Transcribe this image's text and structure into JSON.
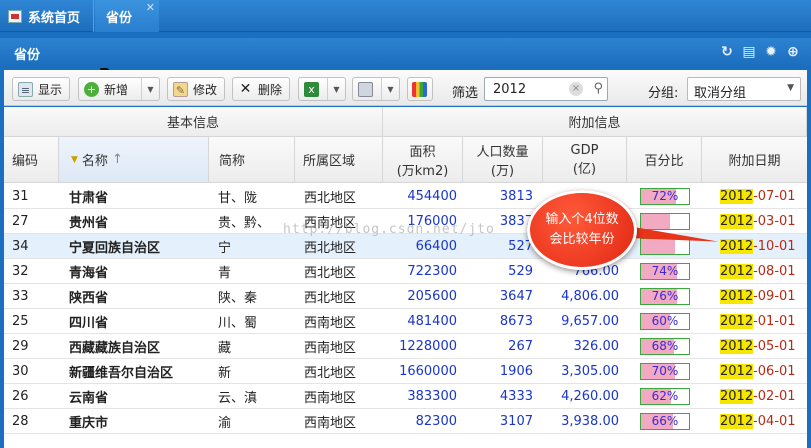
{
  "tabs": [
    {
      "label": "系统首页",
      "close": ""
    },
    {
      "label": "省份",
      "close": "✕"
    }
  ],
  "panel": {
    "title": "省份"
  },
  "header_icons": [
    "refresh-icon",
    "print-icon",
    "gear-icon",
    "add-circle-icon"
  ],
  "toolbar": {
    "show_label": "显示",
    "add_label": "新增",
    "edit_label": "修改",
    "delete_label": "删除",
    "filter_label": "筛选",
    "search_value": "2012",
    "group_label": "分组:",
    "group_value": "取消分组"
  },
  "columns": {
    "group_basic": "基本信息",
    "group_extra": "附加信息",
    "code": "编码",
    "name": "名称",
    "abbr": "简称",
    "region": "所属区域",
    "area_1": "面积",
    "area_2": "(万km2)",
    "pop_1": "人口数量",
    "pop_2": "(万)",
    "gdp_1": "GDP",
    "gdp_2": "(亿)",
    "pct": "百分比",
    "date": "附加日期"
  },
  "rows": [
    {
      "code": "31",
      "name": "甘肃省",
      "abbr": "甘、陇",
      "region": "西北地区",
      "area": "454400",
      "pop": "3813",
      "gdp": "",
      "pct_text": "72%",
      "pct": 0.72,
      "year": "2012",
      "date_rest": "-07-01"
    },
    {
      "code": "27",
      "name": "贵州省",
      "abbr": "贵、黔、",
      "region": "西南地区",
      "area": "176000",
      "pop": "3837",
      "gdp": "",
      "pct_text": "",
      "pct": 0.6,
      "year": "2012",
      "date_rest": "-03-01"
    },
    {
      "code": "34",
      "name": "宁夏回族自治区",
      "abbr": "宁",
      "region": "西北地区",
      "area": "66400",
      "pop": "527",
      "gdp": "",
      "pct_text": "",
      "pct": 0.7,
      "year": "2012",
      "date_rest": "-10-01"
    },
    {
      "code": "32",
      "name": "青海省",
      "abbr": "青",
      "region": "西北地区",
      "area": "722300",
      "pop": "529",
      "gdp": "766.00",
      "pct_text": "74%",
      "pct": 0.74,
      "year": "2012",
      "date_rest": "-08-01"
    },
    {
      "code": "33",
      "name": "陕西省",
      "abbr": "陕、秦",
      "region": "西北地区",
      "area": "205600",
      "pop": "3647",
      "gdp": "4,806.00",
      "pct_text": "76%",
      "pct": 0.76,
      "year": "2012",
      "date_rest": "-09-01"
    },
    {
      "code": "25",
      "name": "四川省",
      "abbr": "川、蜀",
      "region": "西南地区",
      "area": "481400",
      "pop": "8673",
      "gdp": "9,657.00",
      "pct_text": "60%",
      "pct": 0.6,
      "year": "2012",
      "date_rest": "-01-01"
    },
    {
      "code": "29",
      "name": "西藏藏族自治区",
      "abbr": "藏",
      "region": "西南地区",
      "area": "1228000",
      "pop": "267",
      "gdp": "326.00",
      "pct_text": "68%",
      "pct": 0.68,
      "year": "2012",
      "date_rest": "-05-01"
    },
    {
      "code": "30",
      "name": "新疆维吾尔自治区",
      "abbr": "新",
      "region": "西北地区",
      "area": "1660000",
      "pop": "1906",
      "gdp": "3,305.00",
      "pct_text": "70%",
      "pct": 0.7,
      "year": "2012",
      "date_rest": "-06-01"
    },
    {
      "code": "26",
      "name": "云南省",
      "abbr": "云、滇",
      "region": "西南地区",
      "area": "383300",
      "pop": "4333",
      "gdp": "4,260.00",
      "pct_text": "62%",
      "pct": 0.62,
      "year": "2012",
      "date_rest": "-02-01"
    },
    {
      "code": "28",
      "name": "重庆市",
      "abbr": "渝",
      "region": "西南地区",
      "area": "82300",
      "pop": "3107",
      "gdp": "3,938.00",
      "pct_text": "66%",
      "pct": 0.66,
      "year": "2012",
      "date_rest": "-04-01"
    }
  ],
  "callout": {
    "line1": "输入个4位数",
    "line2": "会比较年份"
  },
  "watermark": "http://blog.csdn.net/jto",
  "colors": {
    "header_blue": "#1e6fbd",
    "number_blue": "#1a36c8",
    "year_highlight": "#f7e600",
    "callout_red": "#e02410"
  }
}
